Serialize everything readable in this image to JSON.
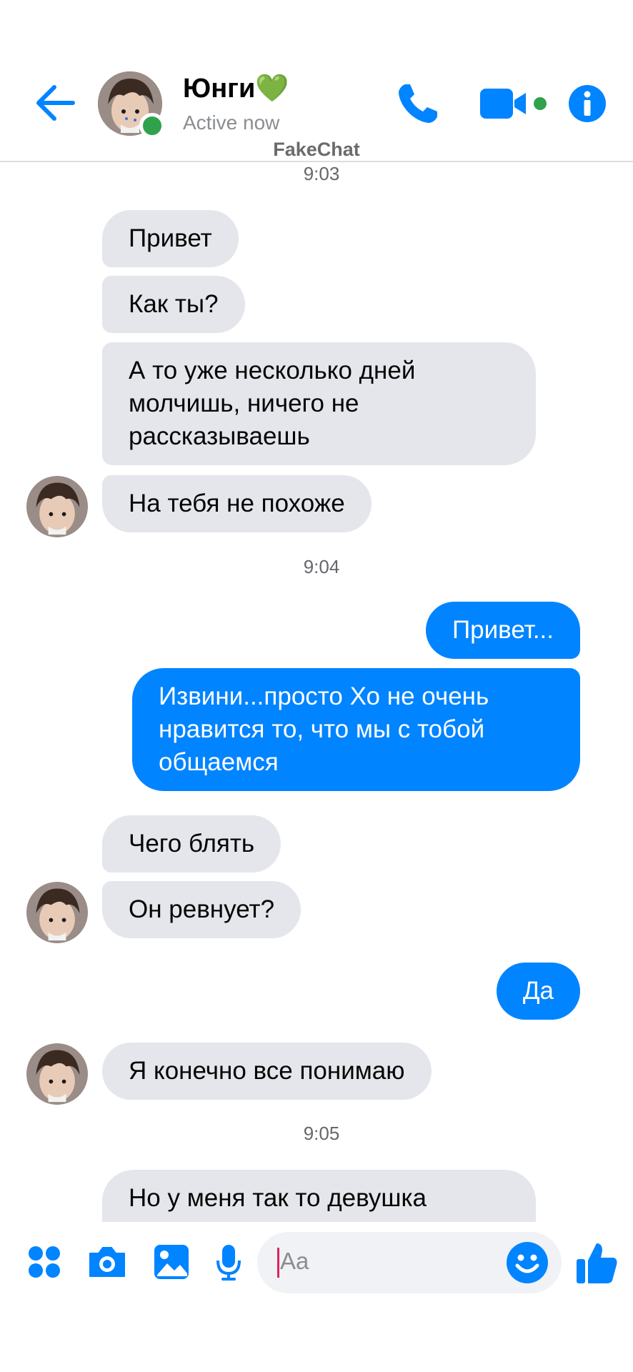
{
  "header": {
    "contact_name": "Юнги💚",
    "status": "Active now"
  },
  "watermark": "FakeChat",
  "timestamps": [
    "9:03",
    "9:04",
    "9:05"
  ],
  "messages": [
    {
      "text": "Привет",
      "side": "in"
    },
    {
      "text": "Как ты?",
      "side": "in"
    },
    {
      "text": "А то уже несколько дней\nмолчишь, ничего не\nрассказываешь",
      "side": "in"
    },
    {
      "text": "На тебя не похоже",
      "side": "in"
    },
    {
      "text": "Привет...",
      "side": "out"
    },
    {
      "text": "Извини...просто Хо не очень\nнравится то, что мы с тобой\nобщаемся",
      "side": "out"
    },
    {
      "text": "Чего блять",
      "side": "in"
    },
    {
      "text": "Он ревнует?",
      "side": "in"
    },
    {
      "text": "Да",
      "side": "out"
    },
    {
      "text": "Я конечно все понимаю",
      "side": "in"
    },
    {
      "text": "Но у меня так то девушка",
      "side": "in"
    }
  ],
  "composer": {
    "placeholder": "Aa"
  },
  "colors": {
    "accent": "#0084ff",
    "incoming_bubble": "#e4e6eb",
    "online": "#31a24c"
  },
  "icons": [
    "back-arrow-icon",
    "phone-icon",
    "video-camera-icon",
    "info-icon",
    "apps-icon",
    "camera-icon",
    "image-icon",
    "microphone-icon",
    "emoji-icon",
    "thumbs-up-icon"
  ]
}
